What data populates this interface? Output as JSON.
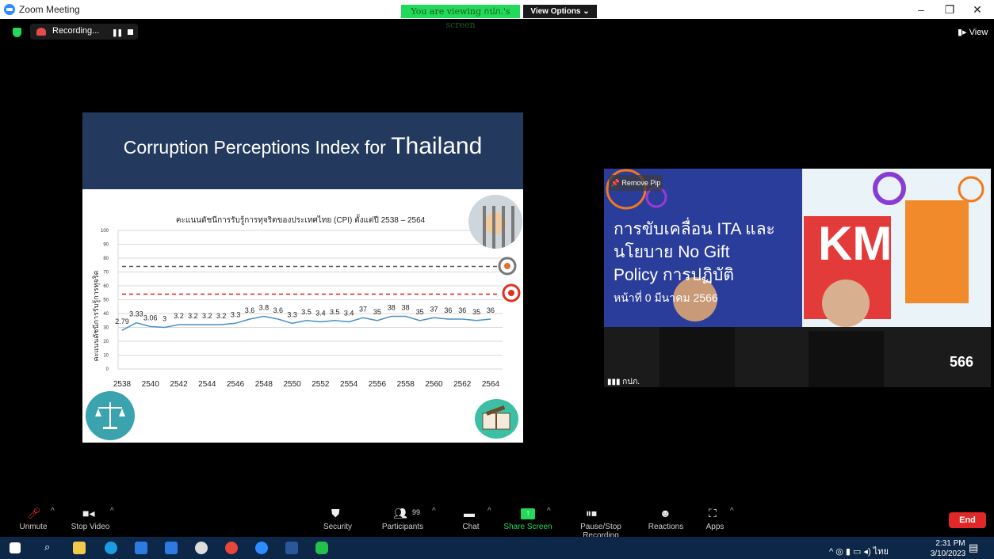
{
  "window": {
    "title": "Zoom Meeting",
    "viewing_banner": "You are viewing กปภ.'s screen",
    "view_options": "View Options ⌄",
    "minimize": "–",
    "restore": "❐",
    "close": "✕"
  },
  "recording": {
    "label": "Recording...",
    "pause": "❚❚"
  },
  "top_right": {
    "view": "▮▸ View"
  },
  "slide": {
    "title_prefix": "Corruption Perceptions Index for ",
    "title_country": "Thailand",
    "chart_title": "คะแนนดัชนีการรับรู้การทุจริตของประเทศไทย (CPI) ตั้งแต่ปี 2538 – 2564",
    "ylabel": "คะแนนดัชนีการรับรู้การทุจริต"
  },
  "chart_data": {
    "type": "line",
    "title": "คะแนนดัชนีการรับรู้การทุจริตของประเทศไทย (CPI) ตั้งแต่ปี 2538 – 2564",
    "ylabel": "คะแนนดัชนีการรับรู้การทุจริต",
    "ylim": [
      0,
      100
    ],
    "yticks": [
      0,
      10,
      20,
      30,
      40,
      50,
      60,
      70,
      80,
      90,
      100
    ],
    "x": [
      2538,
      2539,
      2540,
      2541,
      2542,
      2543,
      2544,
      2545,
      2546,
      2547,
      2548,
      2549,
      2550,
      2551,
      2552,
      2553,
      2554,
      2555,
      2556,
      2557,
      2558,
      2559,
      2560,
      2561,
      2562,
      2563,
      2564
    ],
    "xtick_labels": [
      "2538",
      "2540",
      "2542",
      "2544",
      "2546",
      "2548",
      "2550",
      "2552",
      "2554",
      "2556",
      "2558",
      "2560",
      "2562",
      "2564"
    ],
    "value_labels": [
      "2.79",
      "3.33",
      "3.06",
      "3",
      "3.2",
      "3.2",
      "3.2",
      "3.2",
      "3.3",
      "3.6",
      "3.8",
      "3.6",
      "3.3",
      "3.5",
      "3.4",
      "3.5",
      "3.4",
      "37",
      "35",
      "38",
      "38",
      "35",
      "37",
      "36",
      "36",
      "35",
      "36"
    ],
    "values": [
      27.9,
      33.3,
      30.6,
      30,
      32,
      32,
      32,
      32,
      33,
      36,
      38,
      36,
      33,
      35,
      34,
      35,
      34,
      37,
      35,
      38,
      38,
      35,
      37,
      36,
      36,
      35,
      36
    ],
    "target_lines": [
      74,
      54
    ],
    "target_colors": [
      "#555555",
      "#e02020"
    ]
  },
  "video": {
    "remove_pip": "📌 Remove Pip",
    "name": "กปภ.",
    "overlay_line1": "การขับเคลื่อน ITA และ",
    "overlay_line2": "นโยบาย No Gift",
    "overlay_line3": "Policy      การปฏิบัติ",
    "overlay_line4": "หน้าที่           0 มีนาคม 2566",
    "kmday": "KM",
    "year_fragment": "566"
  },
  "toolbar": {
    "unmute": "Unmute",
    "stop_video": "Stop Video",
    "security": "Security",
    "participants": "Participants",
    "participant_count": "99",
    "chat": "Chat",
    "share_screen": "Share Screen",
    "pause_stop_recording": "Pause/Stop Recording",
    "reactions": "Reactions",
    "apps": "Apps",
    "end": "End"
  },
  "taskbar": {
    "time": "2:31 PM",
    "date": "3/10/2023",
    "lang": "ไทย"
  },
  "colors": {
    "zoom_blue": "#2D8CFF",
    "slide_header": "#233a5e",
    "share_green": "#23d959",
    "end_red": "#e02828",
    "taskbar": "#0d2748"
  }
}
